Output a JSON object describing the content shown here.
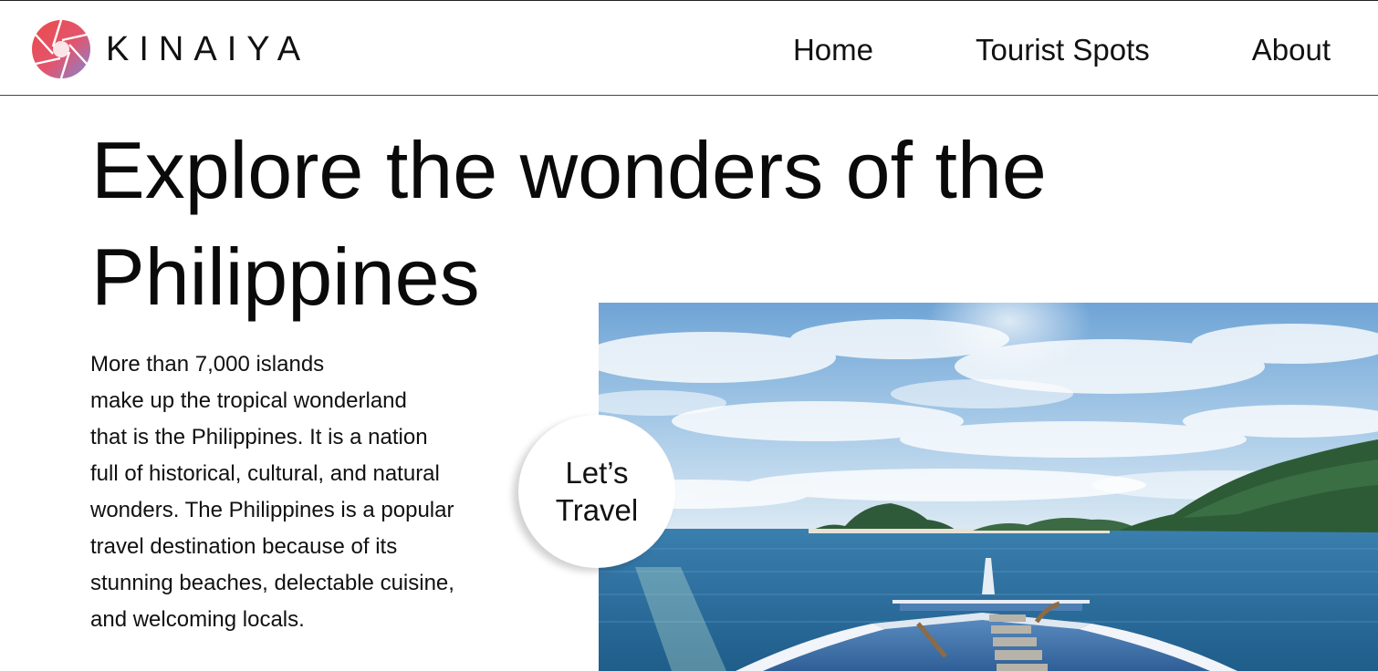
{
  "brand": {
    "name": "KINAIYA",
    "logo_icon": "aperture-logo-icon",
    "colors": [
      "#e8534a",
      "#f06b5a",
      "#d45db0",
      "#8a8fd8",
      "#6f7fd0"
    ]
  },
  "nav": {
    "items": [
      {
        "label": "Home"
      },
      {
        "label": "Tourist Spots"
      },
      {
        "label": "About"
      }
    ]
  },
  "hero": {
    "title_line1": "Explore the wonders of the",
    "title_line2": "Philippines",
    "paragraph_lines": [
      "More than 7,000 islands",
      "make up the tropical wonderland",
      "that is the Philippines. It is a nation",
      "full of historical, cultural, and natural",
      "wonders. The Philippines is a popular",
      "travel destination because of its",
      "stunning beaches, delectable cuisine,",
      "and welcoming locals."
    ]
  },
  "cta": {
    "line1": "Let’s",
    "line2": "Travel"
  },
  "photo": {
    "subject": "boat-bow-ocean-island-photo",
    "sky_color": "#8db8dc",
    "sea_color": "#2b6f9c"
  }
}
